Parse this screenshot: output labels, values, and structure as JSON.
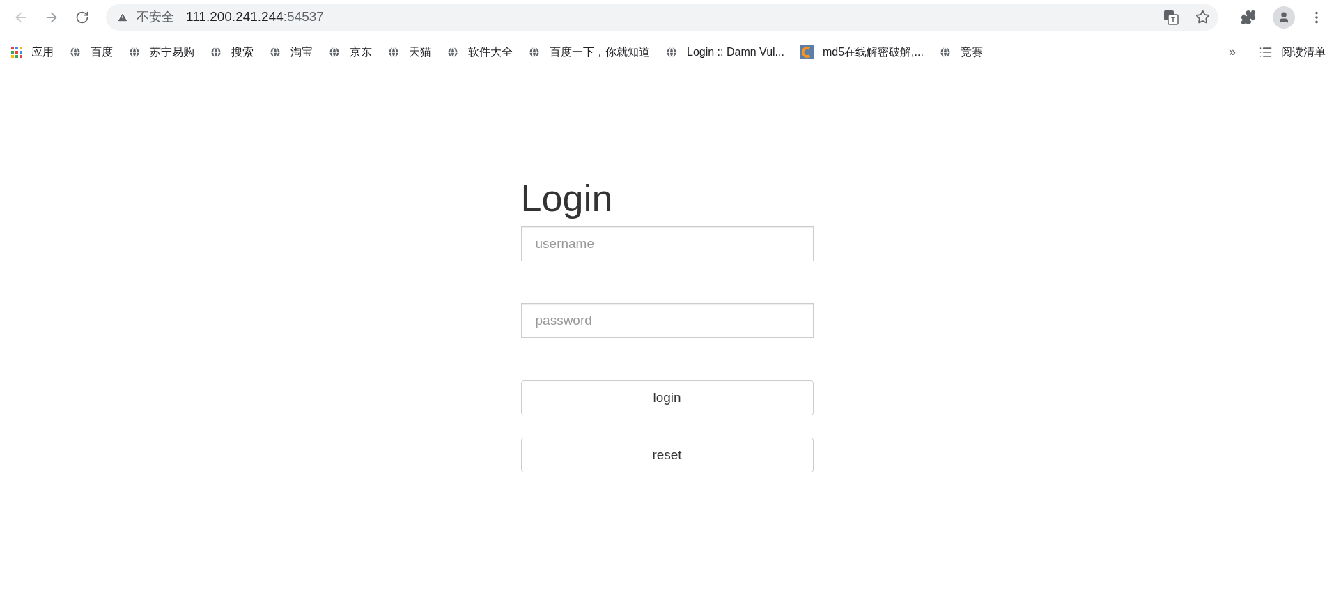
{
  "address_bar": {
    "security_label": "不安全",
    "host": "111.200.241.244",
    "port": ":54537"
  },
  "bookmarks": [
    {
      "kind": "apps",
      "label": "应用"
    },
    {
      "kind": "globe",
      "label": "百度"
    },
    {
      "kind": "globe",
      "label": "苏宁易购"
    },
    {
      "kind": "globe",
      "label": "搜索"
    },
    {
      "kind": "globe",
      "label": "淘宝"
    },
    {
      "kind": "globe",
      "label": "京东"
    },
    {
      "kind": "globe",
      "label": "天猫"
    },
    {
      "kind": "globe",
      "label": "软件大全"
    },
    {
      "kind": "globe",
      "label": "百度一下，你就知道"
    },
    {
      "kind": "globe",
      "label": "Login :: Damn Vul..."
    },
    {
      "kind": "site",
      "label": "md5在线解密破解,..."
    },
    {
      "kind": "globe",
      "label": "竞赛"
    }
  ],
  "bookmarks_overflow": "»",
  "reading_list": "阅读清单",
  "login_form": {
    "title": "Login",
    "fields": [
      {
        "placeholder": "username"
      },
      {
        "placeholder": "password"
      }
    ],
    "buttons": [
      "login",
      "reset"
    ]
  }
}
